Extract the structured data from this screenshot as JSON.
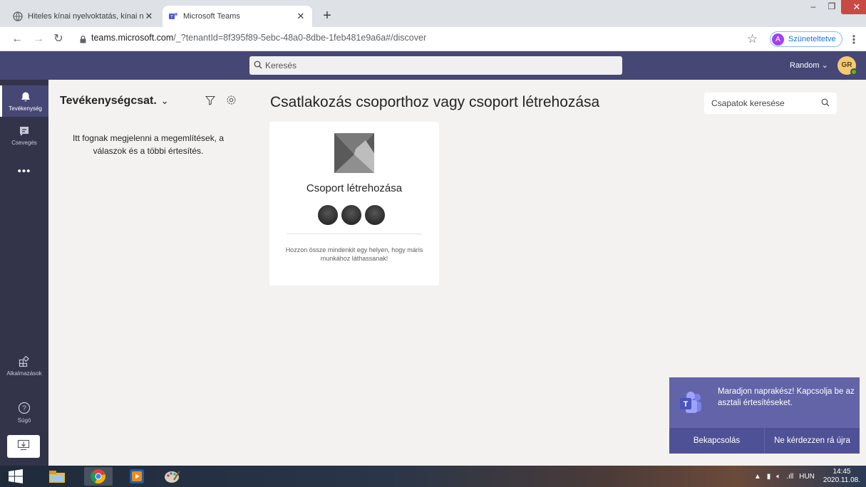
{
  "browser": {
    "tabs": [
      {
        "title": "Hiteles kínai nyelvoktatás, kínai n",
        "active": false
      },
      {
        "title": "Microsoft Teams",
        "active": true
      }
    ],
    "new_tab": "+",
    "url_host": "teams.microsoft.com",
    "url_rest": "/_?tenantId=8f395f89-5ebc-48a0-8dbe-1feb481e9a6a#/discover",
    "profile": {
      "initial": "A",
      "label": "Szüneteltetve"
    }
  },
  "teams": {
    "search_placeholder": "Keresés",
    "tenant": "Random",
    "user_initials": "GR",
    "rail": {
      "activity": "Tevékenység",
      "chat": "Csevegés",
      "more": "•••",
      "apps": "Alkalmazások",
      "help": "Súgó"
    },
    "activity_panel": {
      "title": "Tevékenységcsat.",
      "empty_message": "Itt fognak megjelenni a megemlítések, a válaszok és a többi értesítés."
    },
    "main": {
      "title": "Csatlakozás csoporthoz vagy csoport létrehozása",
      "team_search_placeholder": "Csapatok keresése",
      "card": {
        "title": "Csoport létrehozása",
        "description": "Hozzon össze mindenkit egy helyen, hogy máris munkához láthassanak!"
      }
    },
    "toast": {
      "message": "Maradjon naprakész! Kapcsolja be az asztali értesítéseket.",
      "enable": "Bekapcsolás",
      "dismiss": "Ne kérdezzen rá újra"
    }
  },
  "taskbar": {
    "language": "HUN",
    "time": "14:45",
    "date": "2020.11.08."
  },
  "colors": {
    "teams_purple": "#464775",
    "rail_bg": "#33344a",
    "toast_bg": "#6264a7"
  }
}
